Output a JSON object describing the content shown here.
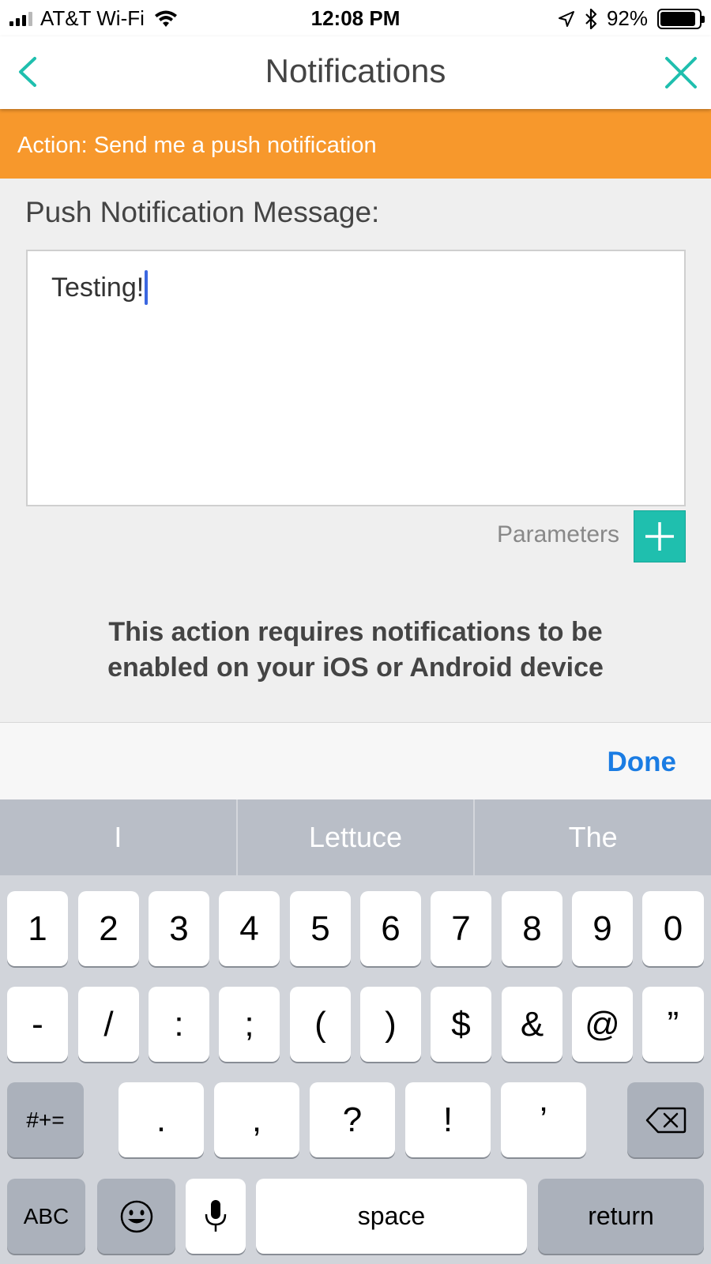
{
  "status_bar": {
    "carrier": "AT&T Wi-Fi",
    "time": "12:08 PM",
    "battery": "92%",
    "icons": [
      "signal-icon",
      "wifi-icon",
      "location-icon",
      "bluetooth-icon",
      "battery-icon"
    ]
  },
  "nav": {
    "title": "Notifications",
    "back_icon": "chevron-left-icon",
    "close_icon": "close-icon"
  },
  "banner": {
    "text": "Action: Send me a push notification"
  },
  "form": {
    "label": "Push Notification Message:",
    "message_value": "Testing!",
    "parameters_label": "Parameters",
    "add_icon": "plus-icon",
    "notice_line1": "This action requires notifications to be",
    "notice_line2": "enabled on your iOS or Android device"
  },
  "accessory": {
    "done_label": "Done"
  },
  "keyboard": {
    "suggestions": [
      "I",
      "Lettuce",
      "The"
    ],
    "row1": [
      "1",
      "2",
      "3",
      "4",
      "5",
      "6",
      "7",
      "8",
      "9",
      "0"
    ],
    "row2": [
      "-",
      "/",
      ":",
      ";",
      "(",
      ")",
      "$",
      "&",
      "@",
      "”"
    ],
    "row3": [
      "#+=",
      ".",
      ",",
      "?",
      "!",
      "’"
    ],
    "row4": {
      "abc": "ABC",
      "space": "space",
      "return": "return"
    },
    "icons": [
      "backspace-icon",
      "emoji-icon",
      "microphone-icon"
    ]
  },
  "colors": {
    "accent": "#1fbfae",
    "banner": "#f7982c",
    "done": "#1a7ce3",
    "caret": "#3b67e0"
  }
}
